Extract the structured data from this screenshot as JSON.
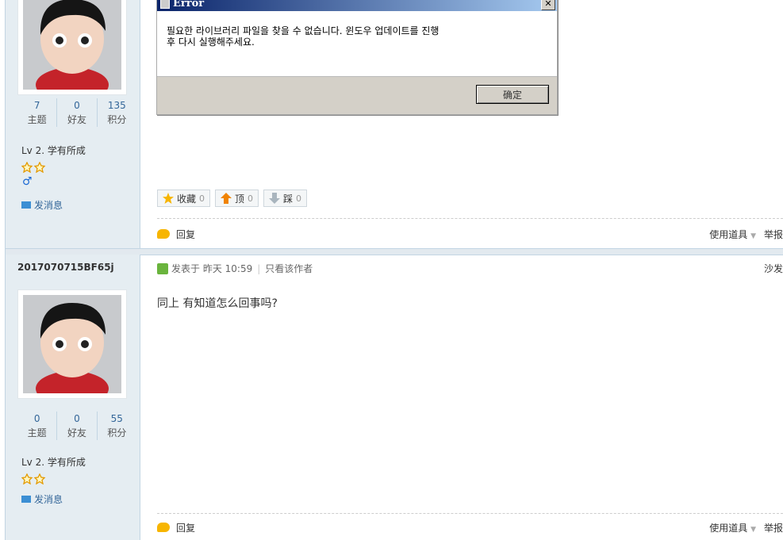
{
  "dialog": {
    "title": "Error",
    "message_line1": "필요한 라이브러리 파일을 찾을 수 없습니다. 윈도우 업데이트를 진행",
    "message_line2": "후 다시 실행해주세요.",
    "ok_label": "确定",
    "close_glyph": "✕"
  },
  "post1": {
    "author": {
      "stats": [
        {
          "value": "7",
          "label": "主题"
        },
        {
          "value": "0",
          "label": "好友"
        },
        {
          "value": "135",
          "label": "积分"
        }
      ],
      "level": "Lv 2. 学有所成",
      "gender_glyph": "♂",
      "message_label": "发消息"
    },
    "actions": [
      {
        "label": "收藏",
        "count": "0",
        "icon": "star-icon"
      },
      {
        "label": "顶",
        "count": "0",
        "icon": "arrow-up-icon"
      },
      {
        "label": "踩",
        "count": "0",
        "icon": "arrow-down-icon"
      }
    ],
    "reply_label": "回复",
    "tools_label": "使用道具",
    "report_label": "举报"
  },
  "post2": {
    "author": {
      "username": "2017070715BF65j",
      "stats": [
        {
          "value": "0",
          "label": "主题"
        },
        {
          "value": "0",
          "label": "好友"
        },
        {
          "value": "55",
          "label": "积分"
        }
      ],
      "level": "Lv 2. 学有所成",
      "message_label": "发消息"
    },
    "posted_label": "发表于 昨天 10:59",
    "only_author_label": "只看该作者",
    "floor_label": "沙发",
    "content": "同上 有知道怎么回事吗?",
    "reply_label": "回复",
    "tools_label": "使用道具",
    "report_label": "举报"
  },
  "colors": {
    "link": "#336699",
    "sidebar": "#e5edf2",
    "accent_star": "#f7b500"
  }
}
